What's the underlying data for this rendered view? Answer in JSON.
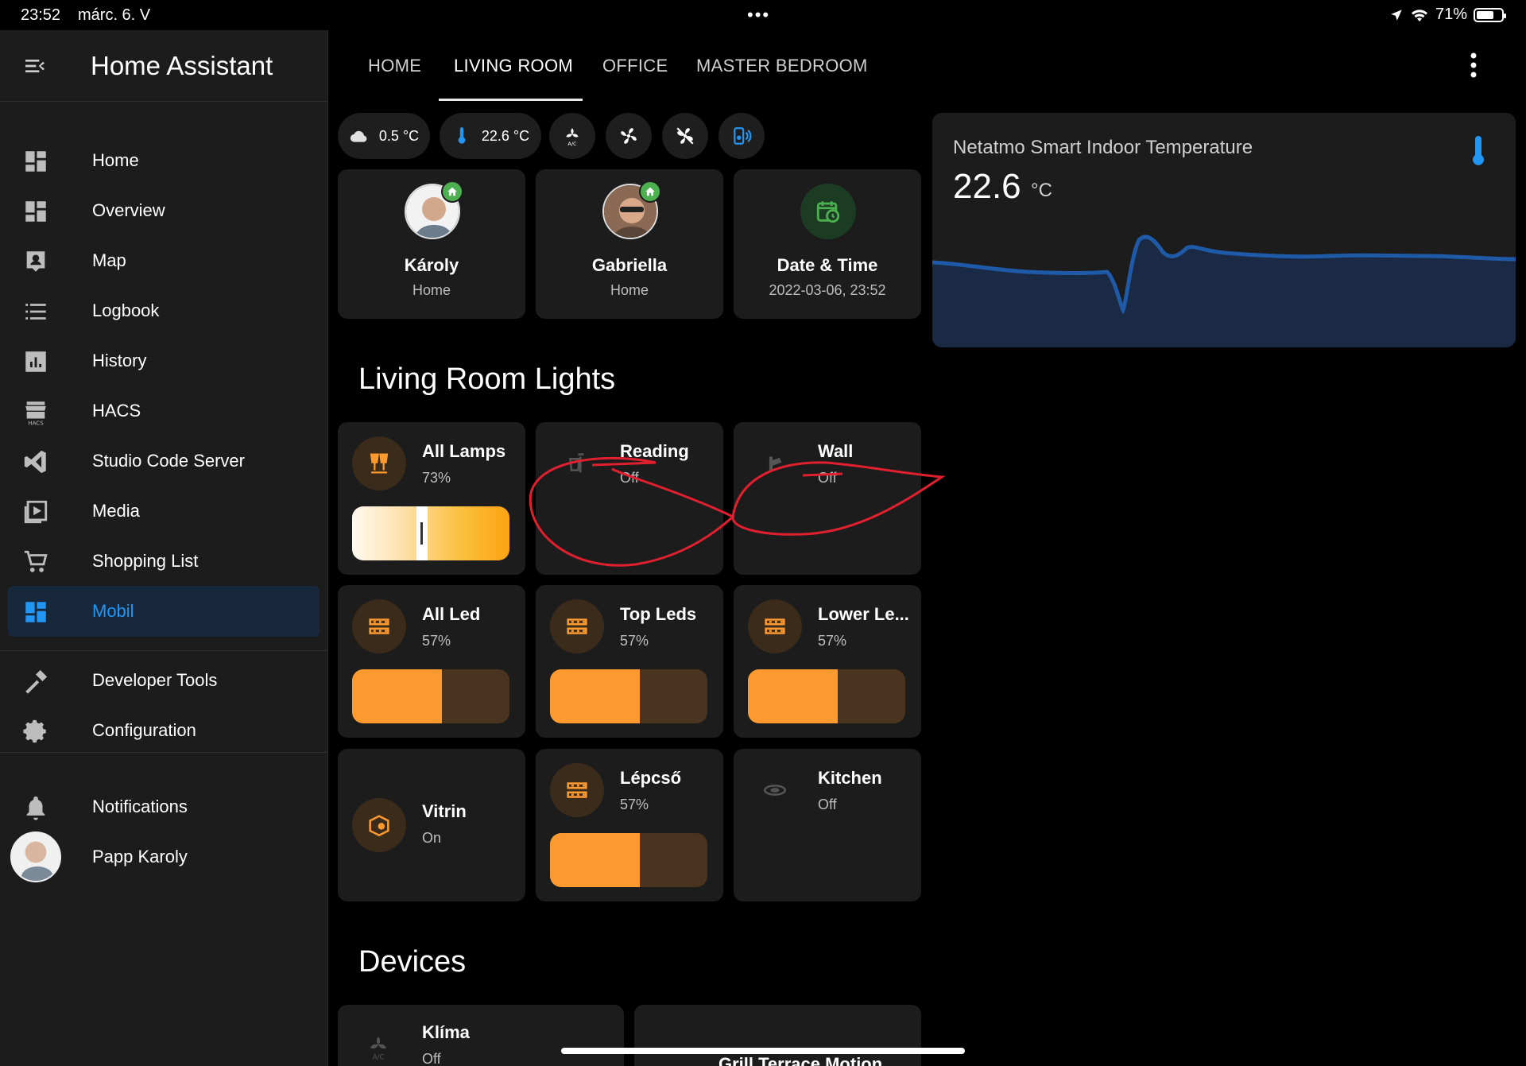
{
  "status": {
    "time": "23:52",
    "date": "márc. 6. V",
    "battery": "71%",
    "battery_level": 0.71
  },
  "sidebar": {
    "title": "Home Assistant",
    "items": [
      {
        "label": "Home",
        "icon": "dashboard-icon"
      },
      {
        "label": "Overview",
        "icon": "dashboard-icon"
      },
      {
        "label": "Map",
        "icon": "map-account-icon"
      },
      {
        "label": "Logbook",
        "icon": "list-icon"
      },
      {
        "label": "History",
        "icon": "chart-bar-icon"
      },
      {
        "label": "HACS",
        "icon": "hacs-store-icon"
      },
      {
        "label": "Studio Code Server",
        "icon": "vscode-icon"
      },
      {
        "label": "Media",
        "icon": "play-box-icon"
      },
      {
        "label": "Shopping List",
        "icon": "cart-icon"
      },
      {
        "label": "Mobil",
        "icon": "dashboard-icon",
        "active": true
      },
      {
        "label": "Developer Tools",
        "icon": "hammer-icon"
      },
      {
        "label": "Configuration",
        "icon": "gear-icon"
      },
      {
        "label": "Notifications",
        "icon": "bell-icon"
      },
      {
        "label": "Papp Karoly",
        "icon": "avatar"
      }
    ]
  },
  "tabs": [
    "HOME",
    "LIVING ROOM",
    "OFFICE",
    "MASTER BEDROOM"
  ],
  "active_tab": "LIVING ROOM",
  "chips": [
    {
      "text": "0.5 °C",
      "icon": "cloud-icon"
    },
    {
      "text": "22.6 °C",
      "icon": "thermometer-icon"
    },
    {
      "icon": "air-conditioner-icon"
    },
    {
      "icon": "fan-icon"
    },
    {
      "icon": "fan-off-icon"
    },
    {
      "icon": "speaker-icon"
    }
  ],
  "persons": [
    {
      "name": "Károly",
      "state": "Home"
    },
    {
      "name": "Gabriella",
      "state": "Home"
    }
  ],
  "datetime": {
    "name": "Date & Time",
    "value": "2022-03-06, 23:52"
  },
  "lights_title": "Living Room Lights",
  "lights": [
    {
      "name": "All Lamps",
      "state": "73%",
      "level": 0.41,
      "kind": "warm"
    },
    {
      "name": "Reading",
      "state": "Off"
    },
    {
      "name": "Wall",
      "state": "Off"
    },
    {
      "name": "All Led",
      "state": "57%",
      "level": 0.57
    },
    {
      "name": "Top Leds",
      "state": "57%",
      "level": 0.57
    },
    {
      "name": "Lower Le...",
      "state": "57%",
      "level": 0.57
    },
    {
      "name": "Vitrin",
      "state": "On"
    },
    {
      "name": "Lépcső",
      "state": "57%",
      "level": 0.57
    },
    {
      "name": "Kitchen",
      "state": "Off"
    }
  ],
  "devices_title": "Devices",
  "devices": [
    {
      "name": "Klíma",
      "state": "Off"
    },
    {
      "name": "Grill Terrace Motion"
    }
  ],
  "temperature": {
    "name": "Netatmo Smart Indoor Temperature",
    "value": "22.6",
    "unit": "°C"
  },
  "colors": {
    "accent": "#2196f3",
    "light_on": "#fd9a2f",
    "annotation": "#e0202e"
  }
}
